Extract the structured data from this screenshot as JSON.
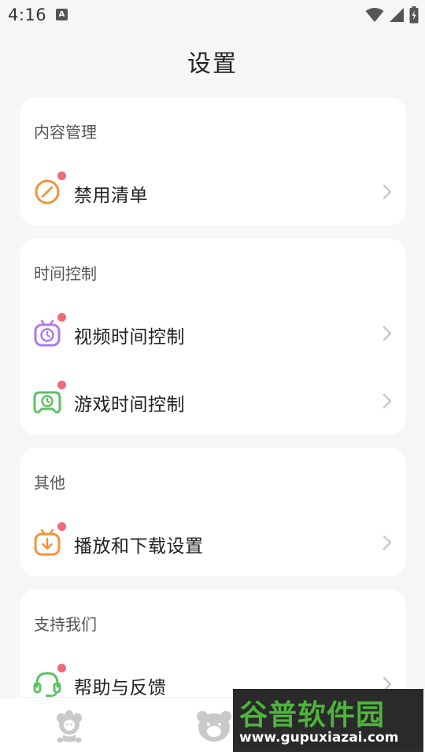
{
  "status_bar": {
    "time": "4:16",
    "notification_glyph": "A",
    "icons": [
      "wifi-icon",
      "signal-icon",
      "battery-charging-icon"
    ]
  },
  "header": {
    "title": "设置"
  },
  "sections": [
    {
      "title": "内容管理",
      "items": [
        {
          "label": "禁用清单",
          "icon": "ban-icon",
          "icon_color": "#f0943b",
          "badge": true
        }
      ]
    },
    {
      "title": "时间控制",
      "items": [
        {
          "label": "视频时间控制",
          "icon": "tv-clock-icon",
          "icon_color": "#b07ae8",
          "badge": true
        },
        {
          "label": "游戏时间控制",
          "icon": "gamepad-clock-icon",
          "icon_color": "#5cc265",
          "badge": true
        }
      ]
    },
    {
      "title": "其他",
      "items": [
        {
          "label": "播放和下载设置",
          "icon": "tv-download-icon",
          "icon_color": "#f0943b",
          "badge": true
        }
      ]
    },
    {
      "title": "支持我们",
      "items": [
        {
          "label": "帮助与反馈",
          "icon": "headset-icon",
          "icon_color": "#5cc265",
          "badge": true
        }
      ]
    }
  ],
  "bottom_nav": {
    "items": [
      {
        "icon": "flower-mascot-icon"
      },
      {
        "icon": "bear-mascot-icon"
      }
    ]
  },
  "watermark": {
    "text": "谷普软件园",
    "url": "www.gupuxiazai.com"
  },
  "colors": {
    "background": "#f6f6f6",
    "card": "#ffffff",
    "badge": "#f06a78",
    "orange": "#f0943b",
    "purple": "#b07ae8",
    "green": "#5cc265"
  }
}
